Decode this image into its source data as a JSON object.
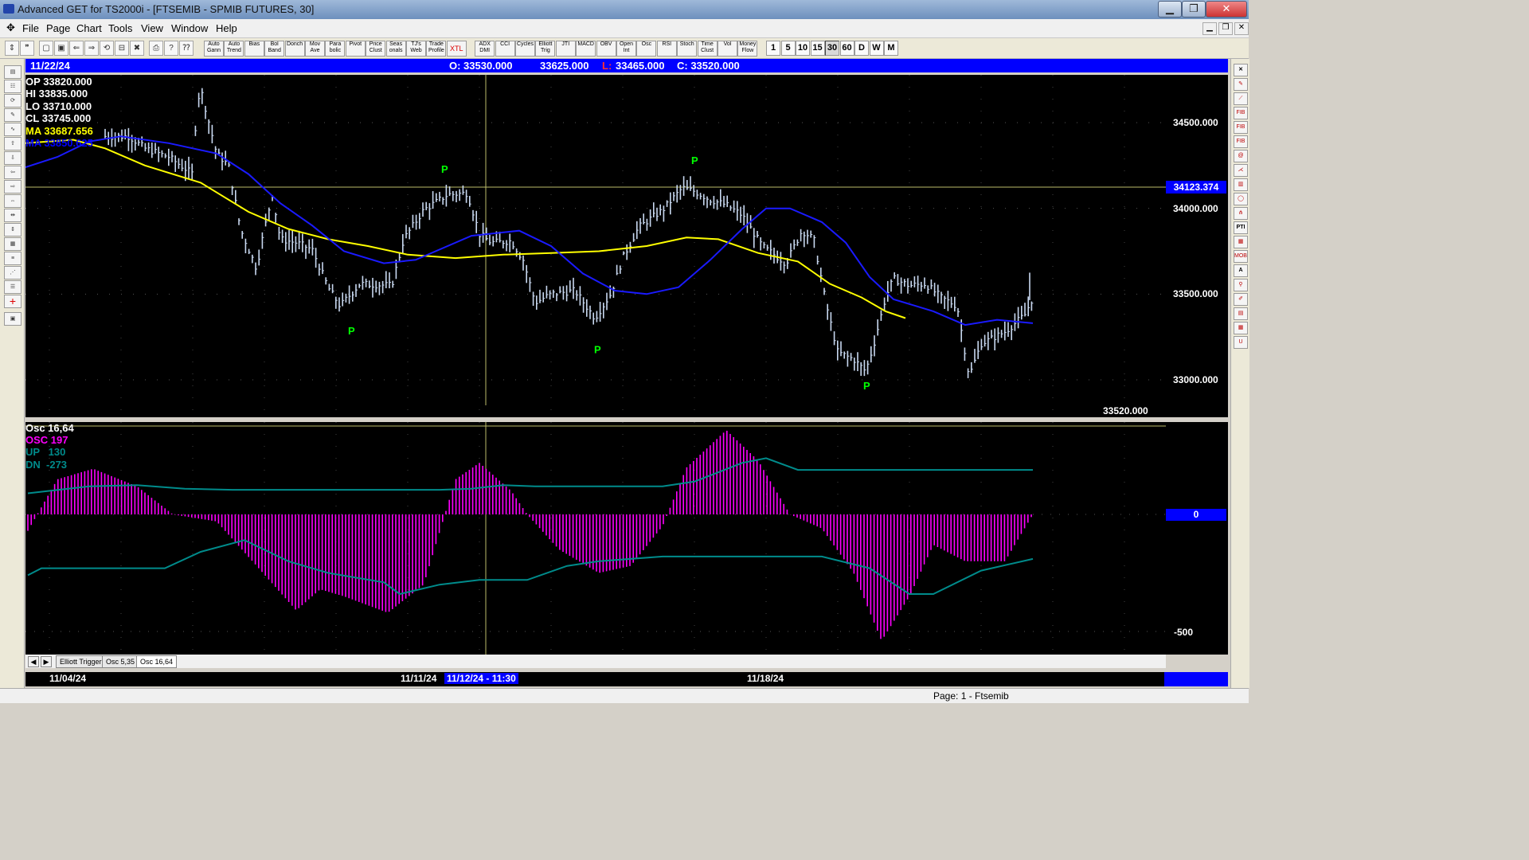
{
  "window": {
    "title": "Advanced GET for TS2000i - [FTSEMIB - SPMIB FUTURES, 30]",
    "minimize": "▁",
    "maximize": "❐",
    "close": "✕"
  },
  "menu": [
    "File",
    "Page",
    "Chart",
    "Tools",
    "View",
    "Window",
    "Help"
  ],
  "toolbar": {
    "study_buttons": [
      "Auto Gann",
      "Auto Trend",
      "Bias",
      "Bol Band",
      "Donch",
      "Mov Ave",
      "Para bolic",
      "Pivot",
      "Price Clust",
      "Seas onals",
      "TJ's Web",
      "Trade Profile",
      "XTL",
      "ADX DMI",
      "CCI",
      "Cycles",
      "Elliott Trig",
      "JTI",
      "MACD",
      "OBV",
      "Open Int",
      "Osc",
      "RSI",
      "Stoch",
      "Time Clust",
      "Vol",
      "Money Flow"
    ],
    "timeframes": [
      "1",
      "5",
      "10",
      "15",
      "30",
      "60",
      "D",
      "W",
      "M"
    ],
    "active_timeframe": "30"
  },
  "info_bar": {
    "date": "11/22/24",
    "open": "O: 33530.000",
    "high": "33625.000",
    "low_label": "L:",
    "low": "33465.000",
    "close": "C: 33520.000"
  },
  "price_panel": {
    "op": {
      "label": "OP",
      "value": "33820.000"
    },
    "hi": {
      "label": "HI",
      "value": "33835.000"
    },
    "lo": {
      "label": "LO",
      "value": "33710.000"
    },
    "cl": {
      "label": "CL",
      "value": "33745.000"
    },
    "ma1": {
      "label": "MA",
      "value": "33687.656",
      "color": "#ffff00"
    },
    "ma2": {
      "label": "MA",
      "value": "33850.625",
      "color": "#0000ff"
    },
    "last_price": "33520.000",
    "crosshair_price": "34123.374",
    "pivot_marker": "P"
  },
  "price_axis": [
    "34500.000",
    "34000.000",
    "33500.000",
    "33000.000"
  ],
  "osc_panel": {
    "title": "Osc 16,64",
    "osc": {
      "label": "OSC",
      "value": "197",
      "color": "#ff00ff"
    },
    "up": {
      "label": "UP",
      "value": "130",
      "color": "#008b8b"
    },
    "dn": {
      "label": "DN",
      "value": "-273",
      "color": "#008b8b"
    }
  },
  "osc_axis": {
    "zero": "0",
    "minus500": "-500"
  },
  "tabs": [
    "Elliott Trigger",
    "Osc 5,35",
    "Osc 16,64"
  ],
  "active_tab": "Osc 16,64",
  "date_axis": {
    "d1": "11/04/24",
    "d2": "11/11/24",
    "cursor": "11/12/24 - 11:30",
    "d3": "11/18/24"
  },
  "status": {
    "page": "Page: 1 - Ftsemib"
  },
  "colors": {
    "bars": "#c8d8f0",
    "ma_fast": "#ffff00",
    "ma_slow": "#1a1aff",
    "osc_hist": "#ff00ff",
    "bands": "#008b8b",
    "pivot": "#00ff00",
    "axis_highlight": "#0000ff"
  }
}
